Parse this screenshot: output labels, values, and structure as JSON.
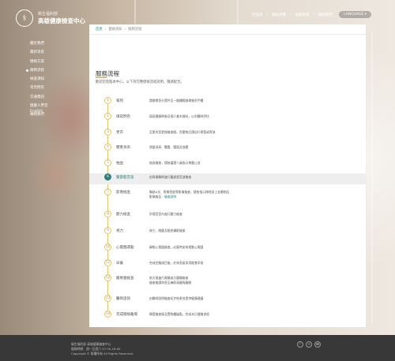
{
  "brand": {
    "sub": "衛生福利部",
    "name": "高雄健康檢查中心",
    "logo_glyph": "⚕"
  },
  "sidebar": {
    "items": [
      {
        "label": "關於我們"
      },
      {
        "label": "最新消息"
      },
      {
        "label": "健檢方案"
      },
      {
        "label": "服務流程"
      },
      {
        "label": "檢查須知"
      },
      {
        "label": "常見問答"
      },
      {
        "label": "交通資訊"
      },
      {
        "label": "健康人學堂"
      },
      {
        "label": "聯絡我們"
      }
    ],
    "active_index": 3,
    "lang": "English"
  },
  "topbar": {
    "items": [
      "回首頁",
      "網站導覽",
      "個資政策",
      "聯絡我們"
    ],
    "lang": "LANGUAGE ▾"
  },
  "breadcrumb": {
    "home": "首頁",
    "level1": "健檢須知",
    "level2": "服務流程"
  },
  "page": {
    "title": "服務流程",
    "subtitle": "歡迎您蒞臨本中心，以下為完整健檢流程說明，敬請配合。"
  },
  "steps": [
    {
      "num": "1",
      "name": "報到",
      "desc": "請攜帶身分證件至一樓櫃檯辦理報到手續"
    },
    {
      "num": "2",
      "name": "填寫問卷",
      "desc": "填寫健康問卷及個人基本資料，以利醫師評估"
    },
    {
      "num": "3",
      "name": "更衣",
      "desc": "至更衣室更換檢查服，貴重物品請自行保管或寄放"
    },
    {
      "num": "4",
      "name": "體重身高",
      "desc": "測量身高、體重、腰圍及血壓"
    },
    {
      "num": "5",
      "name": "抽血",
      "desc": "抽血檢查，請依護理人員指示按壓止血"
    },
    {
      "num": "6",
      "name": "腹部超音波",
      "desc": "由專業醫師進行腹部超音波檢查"
    },
    {
      "num": "7",
      "name": "影像檢查",
      "desc": "胸部X光、骨質密度等影像檢查，請依指示移除身上金屬物品",
      "extra_label": "影像報告：",
      "link": "檢查說明"
    },
    {
      "num": "8",
      "name": "聽力檢查",
      "desc": "於隔音室內進行聽力檢查"
    },
    {
      "num": "9",
      "name": "視力",
      "desc": "視力、眼壓及眼底攝影檢查"
    },
    {
      "num": "10",
      "name": "心電圖運動",
      "desc": "靜態心電圖檢查，必要時安排運動心電圖"
    },
    {
      "num": "11",
      "name": "早餐",
      "desc": "完成空腹項目後，於休息區享用輕食早餐"
    },
    {
      "num": "12",
      "name": "腸胃鏡檢查",
      "desc": "依方案進行胃鏡或大腸鏡檢查",
      "desc2": "檢查後請休息至麻醉清醒再離開"
    },
    {
      "num": "13",
      "name": "醫師諮詢",
      "desc": "由醫師說明檢查初步結果並提供健康建議"
    },
    {
      "num": "14",
      "name": "完成健檢離場",
      "desc": "歸還檢查服及置物櫃鑰匙，完成本日健檢流程"
    }
  ],
  "highlighted_step": 6,
  "footer": {
    "line1": "衛生福利部 高雄健康檢查中心",
    "line2": "服務時間：週一至週六 07:30-16:00",
    "line3": "Copyright © 版權所有 All Rights Reserved.",
    "icons": [
      "f",
      "✉",
      "☎"
    ]
  },
  "colors": {
    "accent": "#2f7c7c",
    "timeline": "#e3c46a",
    "footer": "#383838"
  }
}
